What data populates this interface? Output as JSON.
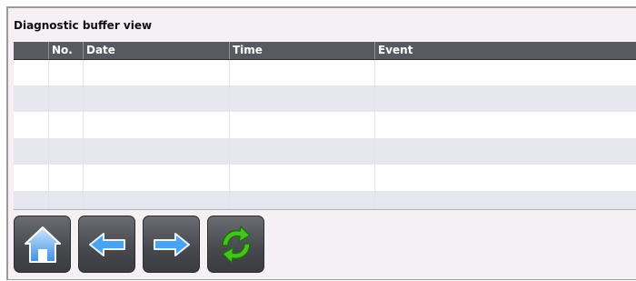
{
  "title": "Diagnostic buffer view",
  "table": {
    "columns": [
      "",
      "No.",
      "Date",
      "Time",
      "Event"
    ],
    "rows": [
      [
        "",
        "",
        "",
        "",
        ""
      ],
      [
        "",
        "",
        "",
        "",
        ""
      ],
      [
        "",
        "",
        "",
        "",
        ""
      ],
      [
        "",
        "",
        "",
        "",
        ""
      ],
      [
        "",
        "",
        "",
        "",
        ""
      ]
    ]
  },
  "toolbar": {
    "buttons": [
      {
        "name": "home",
        "icon": "home-icon"
      },
      {
        "name": "previous",
        "icon": "arrow-left-icon"
      },
      {
        "name": "next",
        "icon": "arrow-right-icon"
      },
      {
        "name": "refresh",
        "icon": "refresh-icon"
      }
    ]
  },
  "colors": {
    "header_bg": "#595a61",
    "row_alt": "#e6e6ee",
    "arrow_blue": "#4aa3f0",
    "refresh_green": "#45c21f"
  }
}
